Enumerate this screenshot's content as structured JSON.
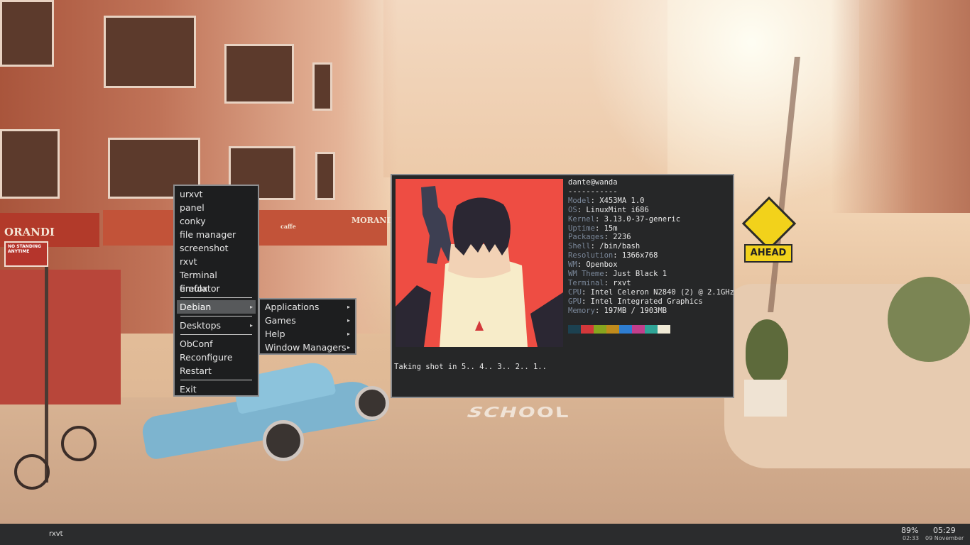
{
  "wallpaper": {
    "signs": {
      "no_standing": "NO STANDING ANYTIME",
      "ahead": "AHEAD",
      "orandi": "ORANDI",
      "morandi": "MORANDI",
      "caffe": "caffe",
      "road": "SCHOOL"
    }
  },
  "menu": {
    "items": [
      {
        "label": "urxvt"
      },
      {
        "label": "panel"
      },
      {
        "label": "conky"
      },
      {
        "label": "file manager"
      },
      {
        "label": "screenshot"
      },
      {
        "label": "rxvt"
      },
      {
        "label": "Terminal emulator"
      },
      {
        "label": "firefox"
      }
    ],
    "debian": "Debian",
    "desktops": "Desktops",
    "obconf": "ObConf",
    "reconfigure": "Reconfigure",
    "restart": "Restart",
    "exit": "Exit",
    "arrow": "▸"
  },
  "submenu": {
    "items": [
      {
        "label": "Applications"
      },
      {
        "label": "Games"
      },
      {
        "label": "Help"
      },
      {
        "label": "Window Managers"
      }
    ]
  },
  "terminal": {
    "userhost": "dante@wanda",
    "underline": "-----------",
    "info": [
      {
        "key": "Model",
        "value": "X453MA 1.0"
      },
      {
        "key": "OS",
        "value": "LinuxMint i686"
      },
      {
        "key": "Kernel",
        "value": "3.13.0-37-generic"
      },
      {
        "key": "Uptime",
        "value": "15m"
      },
      {
        "key": "Packages",
        "value": "2236"
      },
      {
        "key": "Shell",
        "value": "/bin/bash"
      },
      {
        "key": "Resolution",
        "value": "1366x768"
      },
      {
        "key": "WM",
        "value": "Openbox"
      },
      {
        "key": "WM Theme",
        "value": "Just Black 1"
      },
      {
        "key": "Terminal",
        "value": "rxvt"
      },
      {
        "key": "CPU",
        "value": "Intel Celeron N2840 (2) @ 2.1GHz"
      },
      {
        "key": "GPU",
        "value": "Intel Integrated Graphics"
      },
      {
        "key": "Memory",
        "value": "197MB / 1903MB"
      }
    ],
    "colon": ": ",
    "palette": [
      "#1c4150",
      "#d3383a",
      "#87a51e",
      "#c08b1c",
      "#2e7dd1",
      "#c23e8c",
      "#2fa496",
      "#efe9d5"
    ],
    "art_colors": {
      "bg": "#ee4d43",
      "hair": "#2b2733",
      "skin": "#f2d2b5",
      "shirt": "#f7ecc9",
      "gun": "#3d3f52"
    },
    "command_output": "Taking shot in 5.. 4.. 3.. 2.. 1.."
  },
  "panel": {
    "task": "rxvt",
    "battery_percent": "89%",
    "battery_time": "02:33",
    "clock_time": "05:29",
    "clock_date": "09 November"
  }
}
